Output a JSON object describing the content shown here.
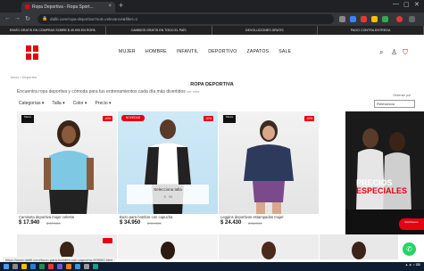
{
  "browser": {
    "tab_title": "Ropa Deportiva - Ropa Sport...",
    "url": "dafiti.com/ropa-deportiva?sort=relevance&filter=1",
    "back": "←",
    "forward": "→",
    "reload": "↻",
    "new_tab": "+",
    "tab_close": "×"
  },
  "promo_bar": [
    "ENVÍO GRATIS EN COMPRAS SOBRE $ 49.990 EN ROPA",
    "CAMBIOS GRATIS EN TODO EL PAÍS",
    "DEVOLUCIONES GRATIS",
    "PAGO CONTRA ENTREGA"
  ],
  "store": {
    "logo_text": "DAFITI",
    "nav": [
      "MUJER",
      "HOMBRE",
      "INFANTIL",
      "DEPORTIVO",
      "ZAPATOS",
      "SALE"
    ]
  },
  "breadcrumb": "Inicio / Deportes",
  "page_title": "ROPA DEPORTIVA",
  "description": "Encuentra ropa deportiva y cómoda para tus entrenamientos cada día más divertidos",
  "description_more": "ver más",
  "filters": [
    "Categorías",
    "Talla",
    "Color",
    "Precio"
  ],
  "filter_arrow": "▾",
  "sort": {
    "label": "Ordenar por",
    "value": "Relevancia"
  },
  "products": [
    {
      "brand": "Marca",
      "discount": "-40%",
      "badge": "",
      "name": "Camiseta deportiva mujer celeste",
      "price": "$ 17.940",
      "old_price": "$ 29.900"
    },
    {
      "brand": "",
      "discount": "-30%",
      "badge": "NOVEDAD",
      "name": "Buzo para hombre con capucha",
      "price": "$ 34.950",
      "old_price": "$ 49.900",
      "size_prompt": "Selecciona talla",
      "sizes": [
        "S",
        "M"
      ]
    },
    {
      "brand": "Marca",
      "discount": "-30%",
      "badge": "",
      "name": "Leggins deportivos estampados mujer",
      "price": "$ 24.430",
      "old_price": "$ 34.900"
    }
  ],
  "promo_card": {
    "line1": "PRECIOS",
    "line2": "ESPECIALES"
  },
  "whatsapp_badge": "Escríbenos",
  "status_url": "https://www.dafiti.com/buzo-para-hombre-con-capucha-909060.html"
}
